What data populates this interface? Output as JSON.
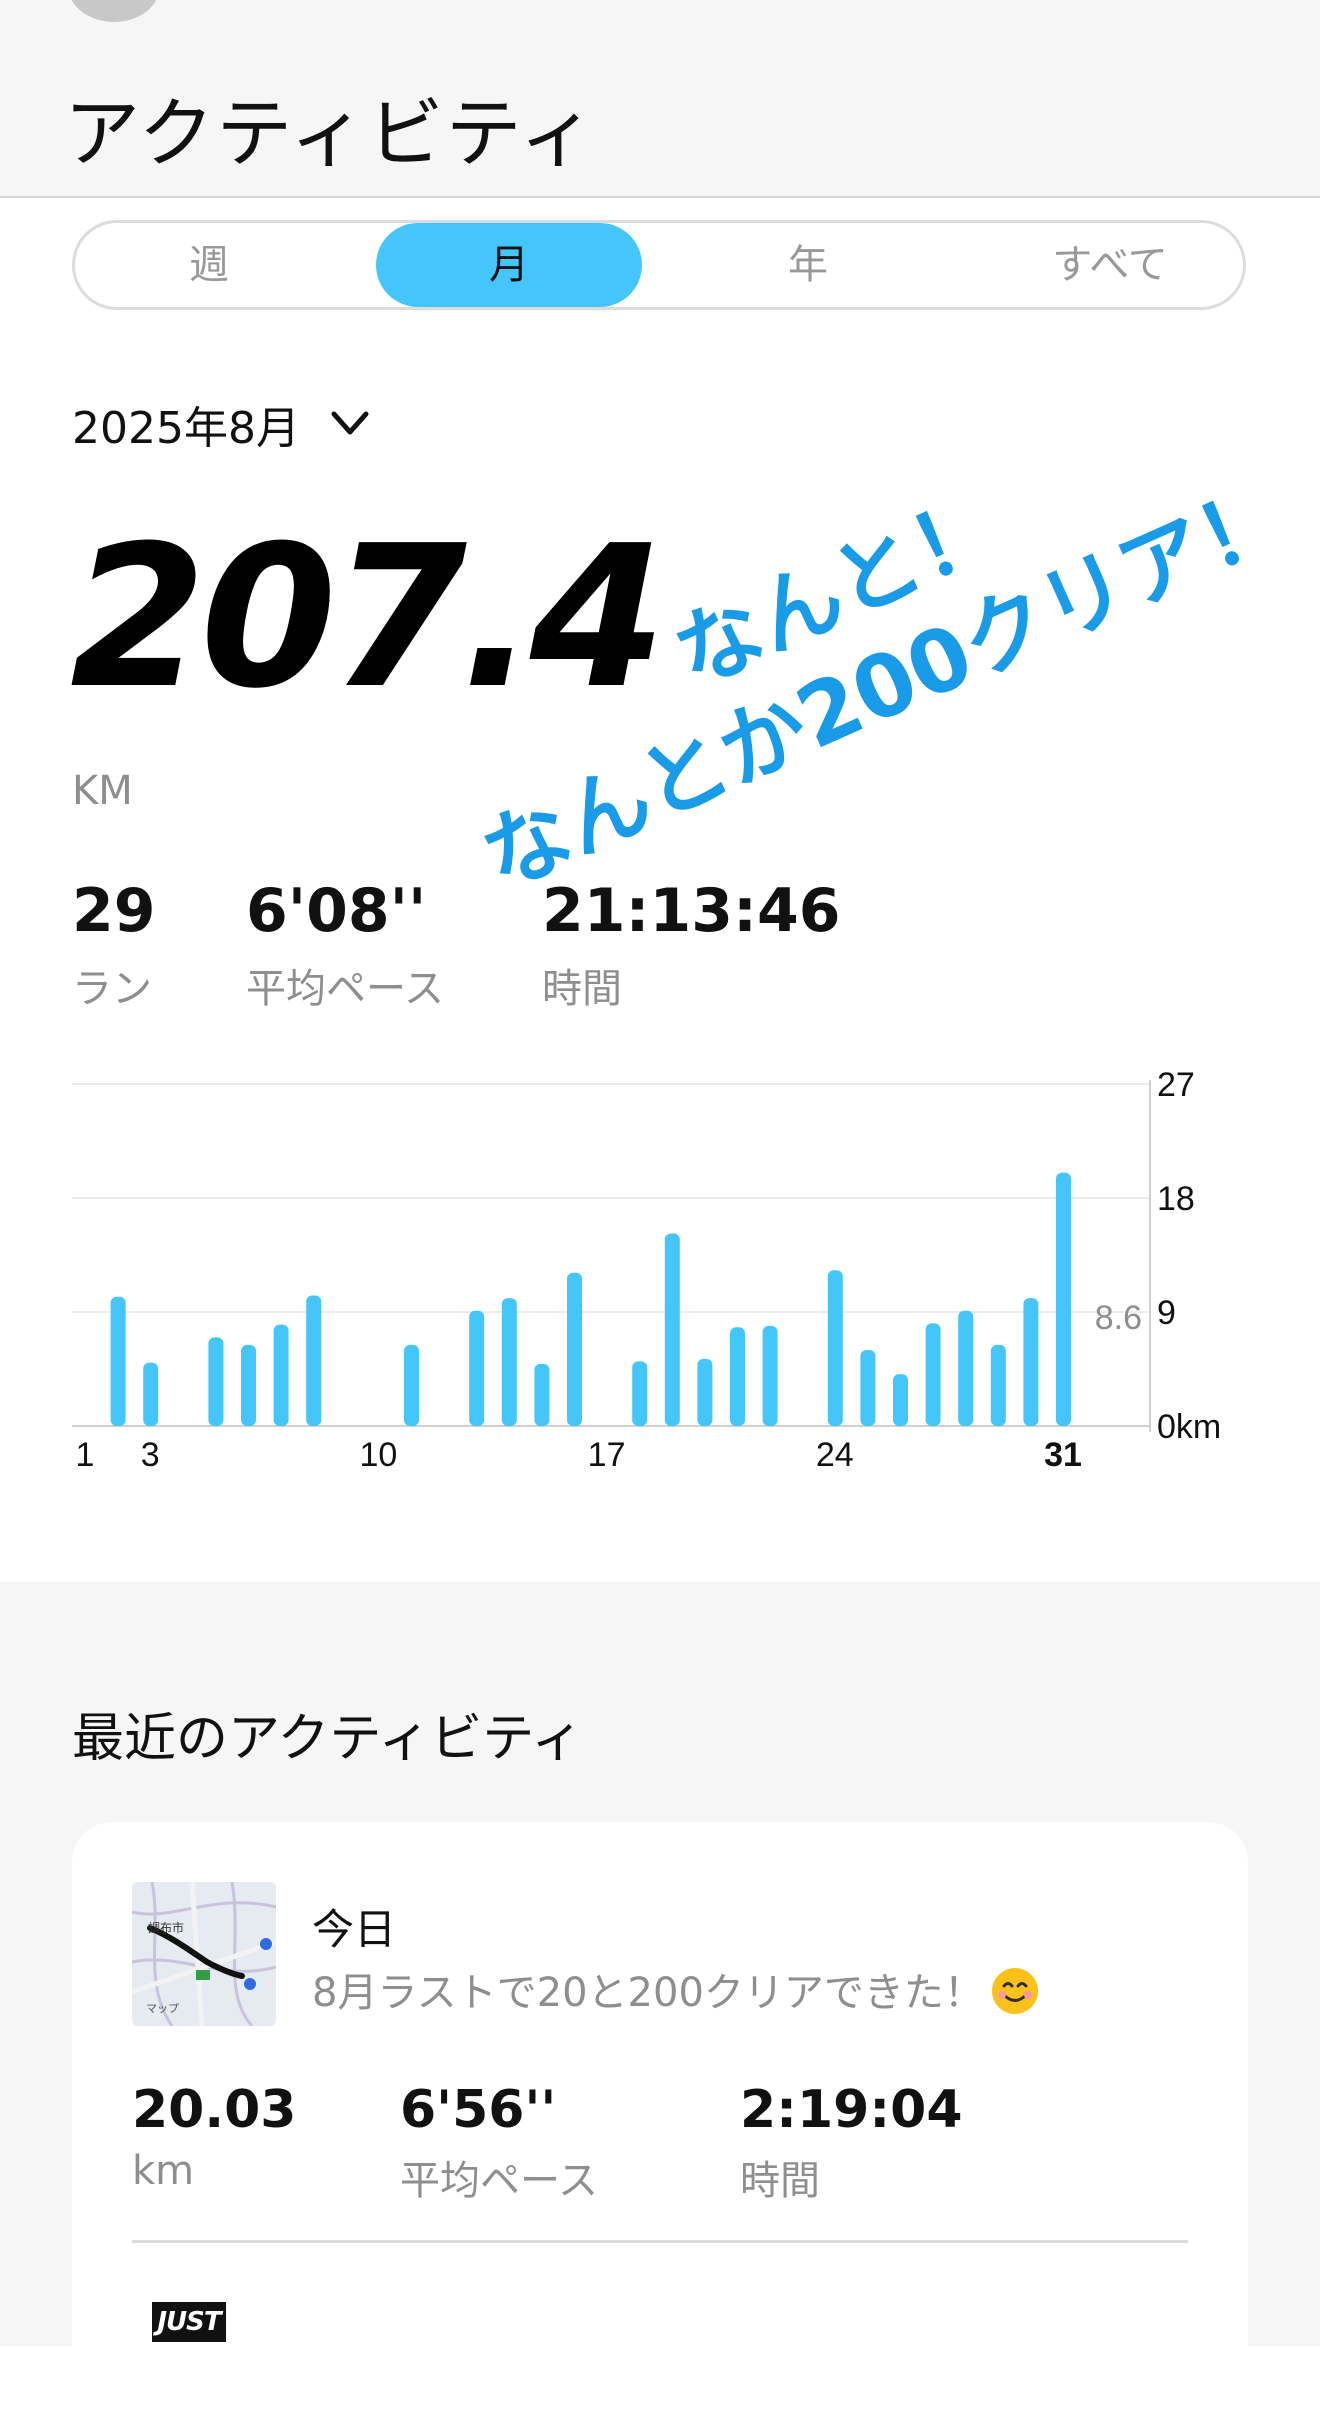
{
  "header": {
    "title": "アクティビティ"
  },
  "period_tabs": [
    {
      "label": "週",
      "selected": false
    },
    {
      "label": "月",
      "selected": true
    },
    {
      "label": "年",
      "selected": false
    },
    {
      "label": "すべて",
      "selected": false
    }
  ],
  "summary": {
    "month": "2025年8月",
    "distance": "207.4",
    "unit": "KM",
    "stats": [
      {
        "value": "29",
        "label": "ラン"
      },
      {
        "value": "6'08''",
        "label": "平均ペース"
      },
      {
        "value": "21:13:46",
        "label": "時間"
      }
    ]
  },
  "annotation": {
    "line1": "なんと！",
    "line2": "なんとか200クリア！"
  },
  "chart_data": {
    "type": "bar",
    "x_labels": [
      "1",
      "3",
      "10",
      "17",
      "24",
      "31"
    ],
    "x_label_days": [
      1,
      3,
      10,
      17,
      24,
      31
    ],
    "bold_x_label": "31",
    "y_ticks": [
      "27",
      "18",
      "9",
      "0km"
    ],
    "y_tick_values": [
      27,
      18,
      9,
      0
    ],
    "ylim": [
      0,
      27
    ],
    "average_label": "8.6",
    "average_value": 8.6,
    "bar_color": "#45c6fb",
    "days": [
      2,
      3,
      5,
      6,
      7,
      8,
      11,
      13,
      14,
      15,
      16,
      18,
      19,
      20,
      21,
      22,
      24,
      25,
      26,
      27,
      28,
      29,
      30,
      31
    ],
    "values": [
      10.2,
      5.0,
      7.0,
      6.4,
      8.0,
      10.3,
      6.4,
      9.1,
      10.1,
      4.9,
      12.1,
      5.1,
      15.2,
      5.3,
      7.8,
      7.9,
      12.3,
      6.0,
      4.1,
      8.1,
      9.1,
      6.4,
      10.1,
      20.0
    ]
  },
  "recent": {
    "title": "最近のアクティビティ",
    "item": {
      "date": "今日",
      "note": "8月ラストで20と200クリアできた！",
      "map_label_city": "調布市",
      "map_label_maps": "マップ",
      "stats": [
        {
          "value": "20.03",
          "label": "km"
        },
        {
          "value": "6'56''",
          "label": "平均ペース"
        },
        {
          "value": "2:19:04",
          "label": "時間"
        }
      ]
    },
    "logo_text": "JUST"
  },
  "colors": {
    "accent": "#45c6fb",
    "annotation": "#1a9be8",
    "muted": "#8e8e8e"
  }
}
